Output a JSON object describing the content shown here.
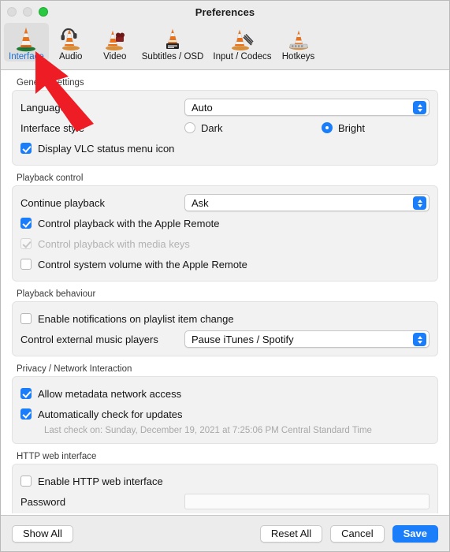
{
  "window": {
    "title": "Preferences",
    "traffic_lights": [
      "close-disabled",
      "minimize-disabled",
      "zoom-green"
    ]
  },
  "toolbar": {
    "tabs": [
      {
        "label": "Interface",
        "icon": "vlc-cone-interface-icon",
        "selected": true
      },
      {
        "label": "Audio",
        "icon": "vlc-cone-audio-icon",
        "selected": false
      },
      {
        "label": "Video",
        "icon": "vlc-cone-video-icon",
        "selected": false
      },
      {
        "label": "Subtitles / OSD",
        "icon": "vlc-cone-subtitles-icon",
        "selected": false
      },
      {
        "label": "Input / Codecs",
        "icon": "vlc-cone-input-icon",
        "selected": false
      },
      {
        "label": "Hotkeys",
        "icon": "vlc-cone-hotkeys-icon",
        "selected": false
      }
    ]
  },
  "sections": {
    "general": {
      "title": "General Settings",
      "language_label": "Language",
      "language_value": "Auto",
      "interface_style_label": "Interface style",
      "style_dark": "Dark",
      "style_bright": "Bright",
      "status_menu_label": "Display VLC status menu icon"
    },
    "playback_control": {
      "title": "Playback control",
      "continue_label": "Continue playback",
      "continue_value": "Ask",
      "apple_remote_label": "Control playback with the Apple Remote",
      "media_keys_label": "Control playback with media keys",
      "system_volume_label": "Control system volume with the Apple Remote"
    },
    "playback_behaviour": {
      "title": "Playback behaviour",
      "notifications_label": "Enable notifications on playlist item change",
      "external_players_label": "Control external music players",
      "external_players_value": "Pause iTunes / Spotify"
    },
    "privacy": {
      "title": "Privacy / Network Interaction",
      "metadata_label": "Allow metadata network access",
      "updates_label": "Automatically check for updates",
      "last_check": "Last check on: Sunday, December 19, 2021 at 7:25:06 PM Central Standard Time"
    },
    "http": {
      "title": "HTTP web interface",
      "enable_label": "Enable HTTP web interface",
      "password_label": "Password",
      "password_value": ""
    }
  },
  "footer": {
    "show_all": "Show All",
    "reset_all": "Reset All",
    "cancel": "Cancel",
    "save": "Save"
  },
  "annotation": {
    "arrow": "red-arrow-pointing-to-interface-tab",
    "color": "#ee1c25"
  },
  "colors": {
    "accent": "#1a7dfa",
    "selected_tab_text": "#1a6fd4",
    "window_chrome": "#ececec",
    "group_background": "#f2f2f2"
  }
}
